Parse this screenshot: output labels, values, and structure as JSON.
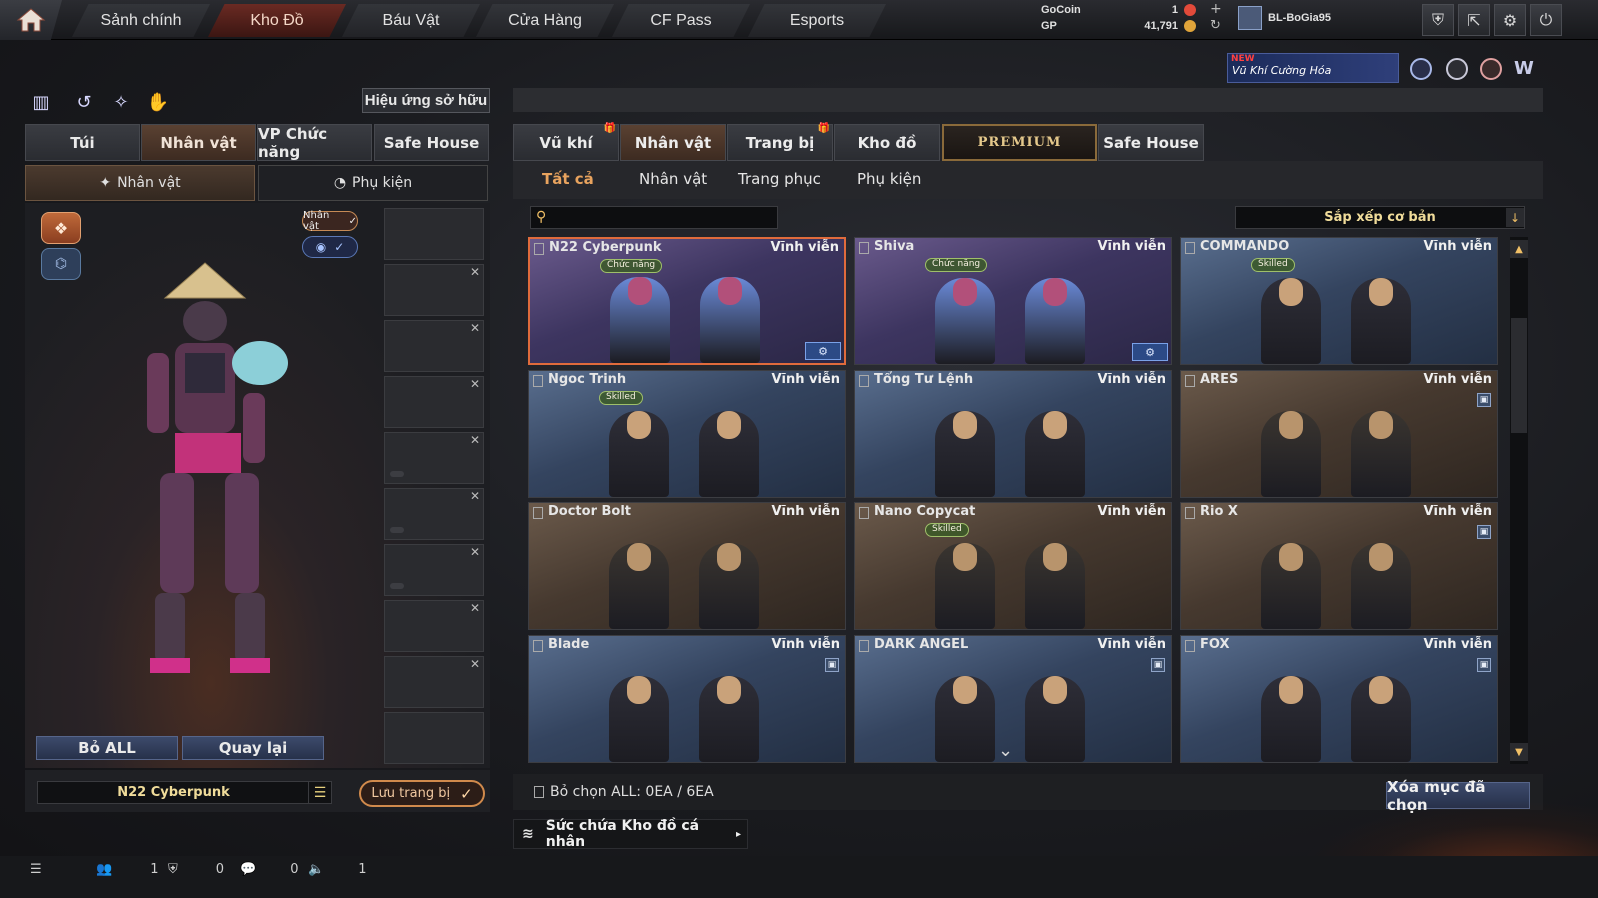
{
  "topbar": {
    "nav": [
      "Sảnh chính",
      "Kho Đồ",
      "Báu Vật",
      "Cửa Hàng",
      "CF Pass",
      "Esports"
    ],
    "active_nav": "Kho Đồ",
    "currencies": [
      {
        "label": "GoCoin",
        "value": "1"
      },
      {
        "label": "GP",
        "value": "41,791"
      }
    ],
    "username": "BL-BoGia95",
    "promo": {
      "badge": "NEW",
      "text": "Vũ Khí Cường Hóa"
    }
  },
  "left": {
    "owned_effect_label": "Hiệu ứng sở hữu",
    "tabs": [
      "Túi",
      "Nhân vật",
      "VP Chức năng",
      "Safe House"
    ],
    "active_tab": "Nhân vật",
    "subtabs": [
      "Nhân vật",
      "Phụ kiện"
    ],
    "badge_label": "Nhân vật",
    "remove_all_label": "Bỏ ALL",
    "back_label": "Quay lại",
    "character_name": "N22 Cyberpunk",
    "save_label": "Lưu trang bị"
  },
  "right": {
    "tabs": [
      "Vũ khí",
      "Nhân vật",
      "Trang bị",
      "Kho đồ",
      "PREMIUM",
      "Safe House"
    ],
    "active_tab": "Nhân vật",
    "subnav": [
      "Tất cả",
      "Nhân vật",
      "Trang phục",
      "Phụ kiện"
    ],
    "active_subnav": "Tất cả",
    "search_placeholder": "",
    "sort_label": "Sắp xếp cơ bản",
    "items": [
      {
        "name": "N22 Cyberpunk",
        "duration": "Vĩnh viễn",
        "tag": "Chức năng",
        "style": "purple",
        "selected": true,
        "tool": true,
        "lock": false
      },
      {
        "name": "Shiva",
        "duration": "Vĩnh viễn",
        "tag": "Chức năng",
        "style": "purple",
        "selected": false,
        "tool": true,
        "lock": false
      },
      {
        "name": "COMMANDO",
        "duration": "Vĩnh viễn",
        "tag": "Skilled",
        "style": "blue",
        "selected": false,
        "tool": false,
        "lock": false
      },
      {
        "name": "Ngoc Trinh",
        "duration": "Vĩnh viễn",
        "tag": "Skilled",
        "style": "blue",
        "selected": false,
        "tool": false,
        "lock": false
      },
      {
        "name": "Tổng Tư Lệnh",
        "duration": "Vĩnh viễn",
        "tag": "",
        "style": "blue",
        "selected": false,
        "tool": false,
        "lock": false
      },
      {
        "name": "ARES",
        "duration": "Vĩnh viễn",
        "tag": "",
        "style": "brown",
        "selected": false,
        "tool": false,
        "lock": true
      },
      {
        "name": "Doctor Bolt",
        "duration": "Vĩnh viễn",
        "tag": "",
        "style": "brown",
        "selected": false,
        "tool": false,
        "lock": false
      },
      {
        "name": "Nano Copycat",
        "duration": "Vĩnh viễn",
        "tag": "Skilled",
        "style": "brown",
        "selected": false,
        "tool": false,
        "lock": false
      },
      {
        "name": "Rio X",
        "duration": "Vĩnh viễn",
        "tag": "",
        "style": "brown",
        "selected": false,
        "tool": false,
        "lock": true
      },
      {
        "name": "Blade",
        "duration": "Vĩnh viễn",
        "tag": "",
        "style": "blue",
        "selected": false,
        "tool": false,
        "lock": true
      },
      {
        "name": "DARK ANGEL",
        "duration": "Vĩnh viễn",
        "tag": "",
        "style": "blue",
        "selected": false,
        "tool": false,
        "lock": true
      },
      {
        "name": "FOX",
        "duration": "Vĩnh viễn",
        "tag": "",
        "style": "blue",
        "selected": false,
        "tool": false,
        "lock": true
      }
    ],
    "deselect_label": "Bỏ chọn ALL: 0EA / 6EA",
    "delete_label": "Xóa mục đã chọn",
    "capacity_label": "Sức chứa Kho đồ cá nhân"
  },
  "footer": {
    "counts": [
      "1",
      "0",
      "0",
      "1"
    ]
  },
  "colors": {
    "accent_orange": "#e8a35e",
    "selected_border": "#e06b3c",
    "gold_text": "#f0dc9a",
    "button_blue": "#3c4a6b"
  }
}
